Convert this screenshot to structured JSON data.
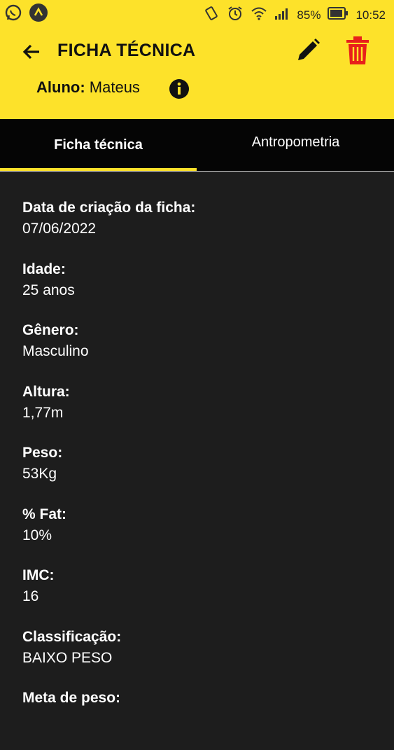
{
  "status_bar": {
    "battery": "85%",
    "time": "10:52",
    "icons": [
      "whatsapp-icon",
      "app-logo-icon",
      "vibrate-icon",
      "alarm-icon",
      "wifi-icon",
      "signal-icon",
      "battery-icon"
    ]
  },
  "header": {
    "title": "FICHA TÉCNICA",
    "student_label": "Aluno:",
    "student_name": "Mateus",
    "icons": [
      "back-arrow-icon",
      "edit-icon",
      "trash-icon",
      "info-icon"
    ],
    "colors": {
      "bar": "#fde22a",
      "trash": "#e8201a"
    }
  },
  "tabs": [
    {
      "label": "Ficha técnica",
      "active": true
    },
    {
      "label": "Antropometria",
      "active": false
    }
  ],
  "fields": [
    {
      "label": "Data de criação da ficha:",
      "value": "07/06/2022"
    },
    {
      "label": "Idade:",
      "value": "25 anos"
    },
    {
      "label": "Gênero:",
      "value": "Masculino"
    },
    {
      "label": "Altura:",
      "value": "1,77m"
    },
    {
      "label": "Peso:",
      "value": "53Kg"
    },
    {
      "label": "% Fat:",
      "value": "10%"
    },
    {
      "label": "IMC:",
      "value": "16"
    },
    {
      "label": "Classificação:",
      "value": "BAIXO PESO"
    },
    {
      "label": "Meta de peso:",
      "value": ""
    }
  ]
}
